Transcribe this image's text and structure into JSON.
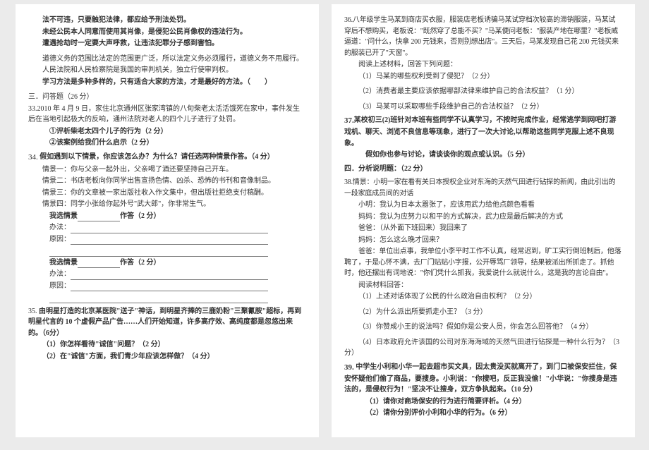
{
  "left": {
    "intro": [
      "法不可违，只要触犯法律，都应给予刑法处罚。",
      "未经公民本人同意而使用其肖像，是侵犯公民肖像权的违法行为。",
      "遭遇抢劫时一定要大声呼救，让违法犯罪分子感到害怕。"
    ],
    "intro2": [
      "道德义务的范围比法定的范围更广泛，所以法定义务必须履行，道德义务不用履行。",
      "人民法院和人民检察院是我国的审判机关，独立行使审判权。",
      "学习方法是多种多样的，只有适合大家的方法，才是最好的方法。（　　）"
    ],
    "section3_title": "三．问答题（26 分）",
    "q33": {
      "num": "33.",
      "text": "2010 年 4 月 9 日，家住北京通州区张家湾镇的八旬柴老太活活饿死在家中，事件发生后在当地引起极大的反响，通州法院对老人的四个儿子进行了处罚。",
      "sub1": "①评析柴老太四个儿子的行为（2 分）",
      "sub2": "②该案例给我们什么启示（2 分）"
    },
    "q34": {
      "num": "34.",
      "lead": "假如遇到以下情景，你应该怎么办？为什么？请任选两种情景作答。（4 分）",
      "s1": "情景一：你与父亲一起外出，父亲喝了酒还要坚持自己开车。",
      "s2": "情景二：书店老板向你同学出售宣扬色情、凶杀、恐怖的书刊和音像制品。",
      "s3": "情景三：你的文章被一家出版社收入作文集中，但出版社拒绝支付稿酬。",
      "s4": "情景四：同学小张给你起外号\"武大郎\"，你非常生气。",
      "choose": "我选情景",
      "answer": "作答（2 分）",
      "method": "办法：",
      "reason": "原因：",
      "choose2": "我选情景",
      "answer2": "作答（2 分）",
      "method2": "办法：",
      "reason2": "原因："
    },
    "q35": {
      "num": "35.",
      "text": "由明星打造的北京某医院\"送子\"神话，到明星齐捧的三鹿奶粉\"三聚氰胺\"超标，再到明星代言的 10 个虚假产品广告……人们开始知道，许多高疗效、高纯度都是忽悠出来的。（6分）",
      "sub1": "（1）你怎样看待\"诚信\"问题？（2 分）",
      "sub2": "（2）在\"诚信\"方面，我们青少年应该怎样做？（4 分）"
    }
  },
  "right": {
    "q36": {
      "num": "36.",
      "text": "八年级学生马某到商店买衣服，服装店老板诱骗马某试穿档次较高的滞销服装，马某试穿后不想购买，老板说：\"既然穿了总能不买？\"马某便问老板：\"服装产地在哪里？\"老板威逼道：\"问什么，快拿 200 元钱来，否则别想出店\"。三天后，马某发现自己花 200 元钱买来的服装已开了\"天窗\"。",
      "read": "阅读上述材料，回答下列问题：",
      "sub1": "（1）马某的哪些权利受到了侵犯？（2 分）",
      "sub2": "（2）消费者最主要应该依据哪部法律来维护自己的合法权益？（1 分）",
      "sub3": "（3）马某可以采取哪些手段维护自己的合法权益？（2 分）"
    },
    "q37": {
      "num": "37.",
      "text": "某校初三(2)班针对本班有些同学不认真学习，不按时完成作业，经常逃学到网吧打游戏机、聊天、浏览不良信息等现象，进行了一次大讨论,以帮助这些同学克服上述不良现象。",
      "ask": "假如你也参与讨论，请谈谈你的观点或认识。（5 分）"
    },
    "section4_title": "四．分析说明题：（22 分）",
    "q38": {
      "num": "38.",
      "lead": "情景：小明一家在看有关日本授权企业对东海的天然气田进行钻探的新闻，由此引出的一段家庭成员间的对话",
      "l1": "小明：我认为日本太嚣张了，应该用武力给他点颜色看看",
      "l2": "妈妈：我认为应努力以和平的方式解决，武力应是最后解决的方式",
      "l3": "爸爸：（从外面下班回来）我回来了",
      "l4": "妈妈：怎么这么晚才回来？",
      "l5": "爸爸：单位出点事，我单位小李平时工作不认真，经常迟到，旷工实行倒班制后，他落聘了，于是心怀不满，去厂门贴贴小字报，公开辱骂厂领导，结果被派出所抓走了。抓他时，他还摆出有词地说：\"你们凭什么抓我，我爱说什么就说什么，这是我的言论自由\"。",
      "read": "阅读材料回答：",
      "sub1": "（1）上述对话体现了公民的什么政治自由权利？（2 分）",
      "sub2": "（2）为什么派出所要抓走小王？（3 分）",
      "sub3": "（3）你赞成小王的说法吗？假如你是公安人员，你会怎么回答他？（4 分）",
      "sub4": "（4）日本政府允许该国的公司对东海海域的天然气田进行钻探是一种什么行为？（3 分）"
    },
    "q39": {
      "num": "39.",
      "text": "中学生小利和小华一起去超市买文具，因太贵没买就离开了，到门口被保安拦住，保安怀疑他们偷了商品，要搜身。小利说：\"你搜吧，反正我没偷！\"小华说：\"你搜身是违法的，是侵权行为！\"坚决不让搜身，双方争执起来。（10 分）",
      "sub1": "（1）请你对商场保安的行为进行简要评析。（4 分）",
      "sub2": "（2）请你分别评价小利和小华的行为。（6 分）"
    }
  }
}
